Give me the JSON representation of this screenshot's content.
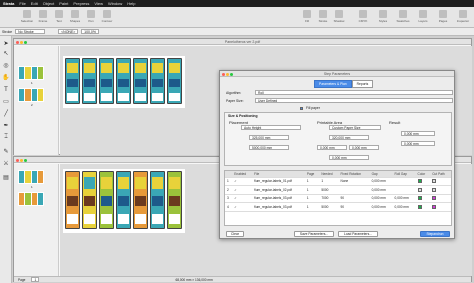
{
  "menubar": {
    "items": [
      "Strata",
      "File",
      "Edit",
      "Object",
      "Paint",
      "Prepress",
      "View",
      "Window",
      "Help"
    ]
  },
  "toolbar": {
    "left": [
      "Selection",
      "Frame",
      "Text",
      "Shapes",
      "Pen",
      "Contour"
    ],
    "right": [
      "Fill",
      "Stroke",
      "Shadow",
      "CMYK",
      "Styles",
      "Swatches",
      "Layers",
      "Pages",
      "Inspector"
    ]
  },
  "propbar": {
    "stroke_label": "Stroke",
    "stroke_value": "No Stroke",
    "style_value": "<NONE>",
    "zoom": "100,0%"
  },
  "doc_top": {
    "title": "Panelutheros ver 2.pdf",
    "page_num": "1",
    "page_num2": "2"
  },
  "doc_bottom": {
    "page_num": "1"
  },
  "dialog": {
    "title": "Step Parameters",
    "tabs": [
      {
        "label": "Parameters & Plan",
        "active": true
      },
      {
        "label": "Reports",
        "active": false
      }
    ],
    "algorithm_label": "Algorithm:",
    "algorithm_value": "Roll",
    "paper_label": "Paper Size:",
    "paper_value": "User Defined",
    "fill_label": "Fill paper",
    "size_section": "Size & Positioning",
    "placement_header": "Placement",
    "placement_mode": "Auto Height",
    "width_value": "325,000 mm",
    "height_value": "5000,000 mm",
    "printable_header": "Printable Area",
    "printable_mode": "Custom Paper Size",
    "pa_width": "320,000 mm",
    "pa_left": "0,000 mm",
    "pa_right": "0,000 mm",
    "pa_bottom": "0,000 mm",
    "result_header": "Result",
    "res_1": "0,000 mm",
    "res_2": "0,000 mm",
    "table": {
      "columns": [
        "",
        "Enabled",
        "File",
        "Page",
        "Needed",
        "Fixed Rotation",
        "Gap",
        "Roll Gap",
        "Color",
        "Cut Path"
      ],
      "rows": [
        {
          "idx": "1",
          "enabled": "✓",
          "file": "flum_regular-labels_01.pdf",
          "page": "1",
          "needed": "1",
          "rotation": "None",
          "gap": "0,000 mm",
          "roll_gap": "",
          "color": "#19b34a",
          "cut": "#e0e0e0"
        },
        {
          "idx": "2",
          "enabled": "✓",
          "file": "flum_regular-labels_02.pdf",
          "page": "1",
          "needed": "5000",
          "rotation": "",
          "gap": "0,000 mm",
          "roll_gap": "",
          "color": "#e0e0e0",
          "cut": "#e0e0e0"
        },
        {
          "idx": "3",
          "enabled": "✓",
          "file": "flum_regular-labels_03.pdf",
          "page": "1",
          "needed": "7000",
          "rotation": "90",
          "gap": "0,000 mm",
          "roll_gap": "0,000 mm",
          "color": "#19b34a",
          "cut": "#d23bd9"
        },
        {
          "idx": "4",
          "enabled": "✓",
          "file": "flum_regular-labels_03.pdf",
          "page": "1",
          "needed": "5000",
          "rotation": "90",
          "gap": "0,000 mm",
          "roll_gap": "0,000 mm",
          "color": "#19b34a",
          "cut": "#d23bd9"
        }
      ]
    },
    "buttons": {
      "clear": "Clear",
      "save": "Save Parameters...",
      "load": "Load Parameters...",
      "step": "Stepandrun"
    }
  },
  "statusbar": {
    "page": "Page",
    "page_num": "1",
    "dims": "68,000 mm × 136,000 mm"
  },
  "colors": {
    "accent": "#4a8be8",
    "label_teal": "#3aa7b5",
    "label_yellow": "#e8d23a",
    "label_orange": "#e79a3a",
    "label_green": "#9bc23b"
  }
}
